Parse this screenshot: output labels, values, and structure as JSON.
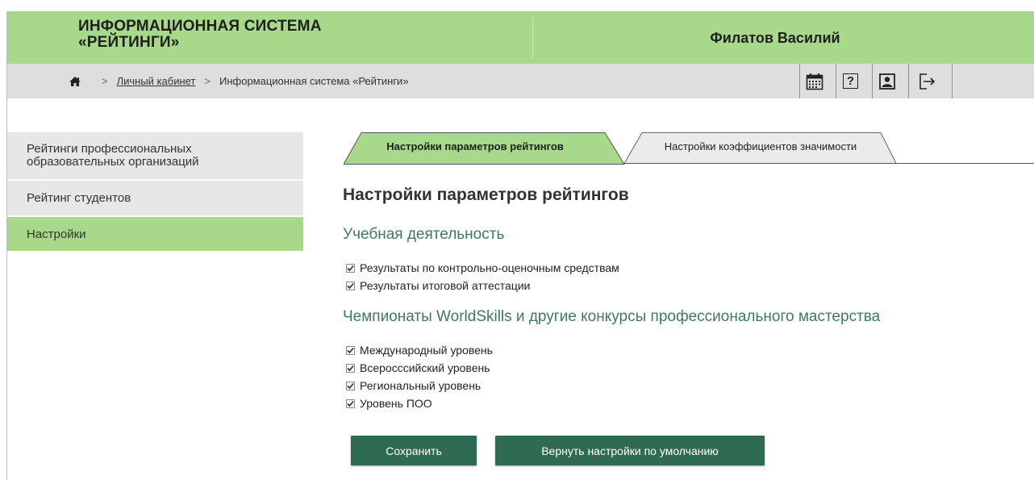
{
  "header": {
    "title": "ИНФОРМАЦИОННАЯ СИСТЕМА\n«РЕЙТИНГИ»",
    "user": "Филатов Василий"
  },
  "breadcrumb": {
    "home_icon": "home-icon",
    "items": [
      {
        "label": "Личный кабинет",
        "link": true
      },
      {
        "label": "Информационная система «Рейтинги»",
        "link": false
      }
    ]
  },
  "toolbar": {
    "icons": [
      "calendar-icon",
      "help-icon",
      "profile-icon",
      "logout-icon"
    ],
    "help_glyph": "?"
  },
  "sidebar": {
    "items": [
      {
        "label": "Рейтинги профессиональных образовательных организаций",
        "active": false
      },
      {
        "label": "Рейтинг студентов",
        "active": false
      },
      {
        "label": "Настройки",
        "active": true
      }
    ]
  },
  "tabs": [
    {
      "label": "Настройки параметров рейтингов",
      "active": true
    },
    {
      "label": "Настройки коэффициентов значимости",
      "active": false
    }
  ],
  "main": {
    "title": "Настройки параметров рейтингов",
    "sections": [
      {
        "title": "Учебная деятельность",
        "items": [
          {
            "label": "Результаты по контрольно-оценочным средствам",
            "checked": true
          },
          {
            "label": "Результаты итоговой аттестации",
            "checked": true
          }
        ]
      },
      {
        "title": "Чемпионаты WorldSkills и другие конкурсы профессионального мастерства",
        "items": [
          {
            "label": "Международный уровень",
            "checked": true
          },
          {
            "label": "Всеросссийский уровень",
            "checked": true
          },
          {
            "label": "Региональный уровень",
            "checked": true
          },
          {
            "label": "Уровень ПОО",
            "checked": true
          }
        ]
      }
    ]
  },
  "buttons": {
    "save": "Сохранить",
    "reset": "Вернуть настройки по умолчанию"
  },
  "colors": {
    "header_bg": "#a8d98a",
    "bar_bg": "#dedede",
    "accent_text": "#3f7a5c",
    "button_bg": "#2f6b52"
  }
}
